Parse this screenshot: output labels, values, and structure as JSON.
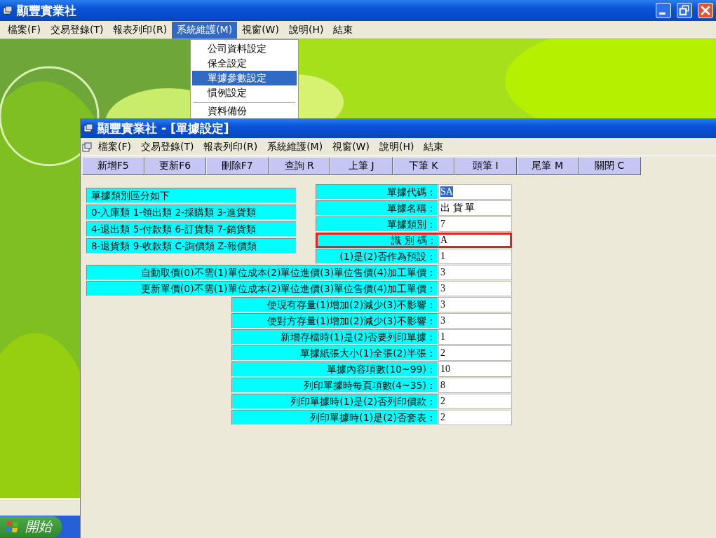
{
  "window": {
    "title": "顯豐實業社"
  },
  "menu_bar": [
    {
      "label": "檔案(F)",
      "selected": false
    },
    {
      "label": "交易登錄(T)",
      "selected": false
    },
    {
      "label": "報表列印(R)",
      "selected": false
    },
    {
      "label": "系統維護(M)",
      "selected": true
    },
    {
      "label": "視窗(W)",
      "selected": false
    },
    {
      "label": "說明(H)",
      "selected": false
    },
    {
      "label": "結束",
      "selected": false
    }
  ],
  "dropdown": {
    "items": [
      {
        "kind": "item",
        "label": "公司資料設定",
        "selected": false
      },
      {
        "kind": "item",
        "label": "保全設定",
        "selected": false
      },
      {
        "kind": "item",
        "label": "單據參數設定",
        "selected": true
      },
      {
        "kind": "item",
        "label": "慣例設定",
        "selected": false
      },
      {
        "kind": "separator"
      },
      {
        "kind": "item",
        "label": "資料備份",
        "selected": false
      }
    ]
  },
  "child_window": {
    "title": "顯豐實業社 - [單據設定]",
    "menu": [
      "檔案(F)",
      "交易登錄(T)",
      "報表列印(R)",
      "系統維護(M)",
      "視窗(W)",
      "說明(H)",
      "結束"
    ],
    "toolbar": [
      "新增F5",
      "更新F6",
      "刪除F7",
      "查詢 R",
      "上筆 J",
      "下筆 K",
      "頭筆 I",
      "尾筆 M",
      "關閉 C"
    ],
    "category_notes": [
      "單據類別區分如下",
      "0-入庫類 1-領出類 2-採購類 3-進貨類",
      "4-退出類 5-付款類 6-訂貨類 7-銷貨類",
      "8-退貨類 9-收款類 C-詢價類 Z-報價類"
    ],
    "fields": [
      {
        "kind": "narrow",
        "label": "單據代碼：",
        "value": "SA",
        "value_selected": true,
        "highlighted": false
      },
      {
        "kind": "narrow",
        "label": "單據名稱：",
        "value": "出 貨 單",
        "value_selected": false,
        "highlighted": false
      },
      {
        "kind": "narrow",
        "label": "單據類別：",
        "value": "7",
        "value_selected": false,
        "highlighted": false
      },
      {
        "kind": "narrow",
        "label": "識 別 碼：",
        "value": "A",
        "value_selected": false,
        "highlighted": true
      },
      {
        "kind": "narrow",
        "label": "(1)是(2)否作為預設：",
        "value": "1",
        "value_selected": false,
        "highlighted": false
      },
      {
        "kind": "wide",
        "label": "自動取價(0)不需(1)單位成本(2)單位進價(3)單位售價(4)加工單價：",
        "value": "3",
        "value_selected": false,
        "highlighted": false
      },
      {
        "kind": "wide",
        "label": "更新單價(0)不需(1)單位成本(2)單位進價(3)單位售價(4)加工單價：",
        "value": "3",
        "value_selected": false,
        "highlighted": false
      },
      {
        "kind": "mid",
        "label": "使現有存量(1)增加(2)減少(3)不影響：",
        "value": "3",
        "value_selected": false,
        "highlighted": false
      },
      {
        "kind": "mid",
        "label": "使對方存量(1)增加(2)減少(3)不影響：",
        "value": "3",
        "value_selected": false,
        "highlighted": false
      },
      {
        "kind": "mid",
        "label": "新增存檔時(1)是(2)否要列印單據：",
        "value": "1",
        "value_selected": false,
        "highlighted": false
      },
      {
        "kind": "mid",
        "label": "單據紙張大小(1)全張(2)半張：",
        "value": "2",
        "value_selected": false,
        "highlighted": false
      },
      {
        "kind": "mid",
        "label": "單據內容項數(10~99)：",
        "value": "10",
        "value_selected": false,
        "highlighted": false
      },
      {
        "kind": "mid",
        "label": "列印單據時每頁項數(4~35)：",
        "value": "8",
        "value_selected": false,
        "highlighted": false
      },
      {
        "kind": "mid",
        "label": "列印單據時(1)是(2)否列印價款：",
        "value": "2",
        "value_selected": false,
        "highlighted": false
      },
      {
        "kind": "mid",
        "label": "列印單據時(1)是(2)否套表：",
        "value": "2",
        "value_selected": false,
        "highlighted": false
      }
    ]
  },
  "taskbar": {
    "start_label": "開始"
  }
}
